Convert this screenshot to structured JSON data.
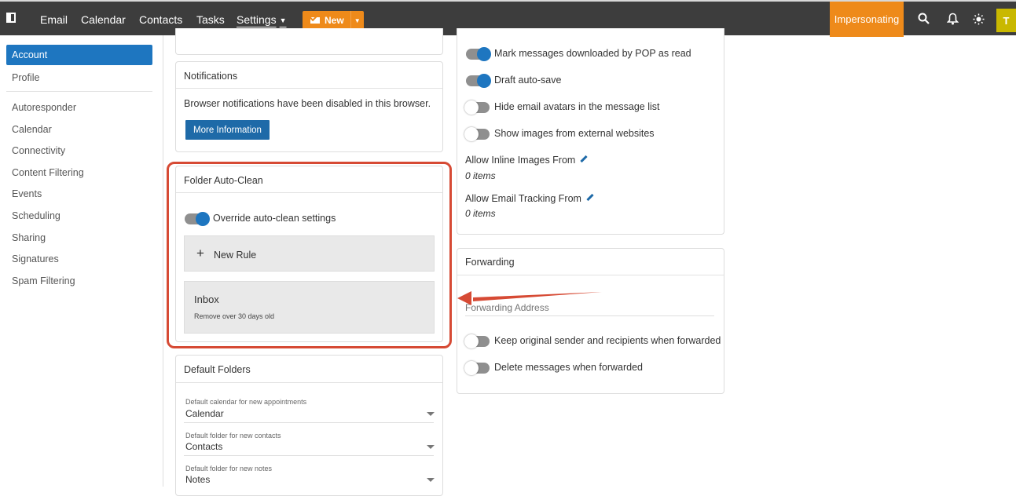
{
  "topbar": {
    "nav": [
      "Email",
      "Calendar",
      "Contacts",
      "Tasks",
      "Settings"
    ],
    "new_label": "New",
    "impersonating": "Impersonating",
    "avatar_initial": "T"
  },
  "sidebar": {
    "active": "Account",
    "profile": "Profile",
    "items": [
      "Autoresponder",
      "Calendar",
      "Connectivity",
      "Content Filtering",
      "Events",
      "Scheduling",
      "Sharing",
      "Signatures",
      "Spam Filtering"
    ]
  },
  "notifications": {
    "title": "Notifications",
    "message": "Browser notifications have been disabled in this browser.",
    "button": "More Information"
  },
  "auto_clean": {
    "title": "Folder Auto-Clean",
    "override_label": "Override auto-clean settings",
    "new_rule": "New Rule",
    "rule_folder": "Inbox",
    "rule_desc": "Remove over 30 days old"
  },
  "default_folders": {
    "title": "Default Folders",
    "fields": [
      {
        "label": "Default calendar for new appointments",
        "value": "Calendar"
      },
      {
        "label": "Default folder for new contacts",
        "value": "Contacts"
      },
      {
        "label": "Default folder for new notes",
        "value": "Notes"
      }
    ]
  },
  "email_options": {
    "toggles": [
      {
        "label": "Mark messages downloaded by POP as read",
        "on": true
      },
      {
        "label": "Draft auto-save",
        "on": true
      },
      {
        "label": "Hide email avatars in the message list",
        "on": false
      },
      {
        "label": "Show images from external websites",
        "on": false
      }
    ],
    "inline_images_label": "Allow Inline Images From",
    "inline_images_count": "0 items",
    "tracking_label": "Allow Email Tracking From",
    "tracking_count": "0 items"
  },
  "forwarding": {
    "title": "Forwarding",
    "address_placeholder": "Forwarding Address",
    "toggles": [
      {
        "label": "Keep original sender and recipients when forwarded",
        "on": false
      },
      {
        "label": "Delete messages when forwarded",
        "on": false
      }
    ]
  },
  "colors": {
    "accent": "#1e76c0",
    "orange": "#ee8a1a",
    "highlight": "#d64a34",
    "topbar": "#3d3d3d"
  }
}
